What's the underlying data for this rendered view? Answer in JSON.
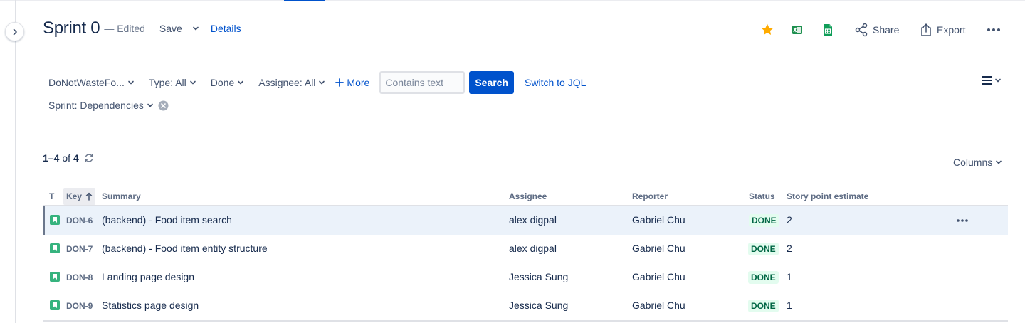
{
  "header": {
    "title": "Sprint 0",
    "edited": "— Edited",
    "save_label": "Save",
    "details_label": "Details",
    "share_label": "Share",
    "export_label": "Export"
  },
  "filters": {
    "project": "DoNotWasteFo...",
    "type": "Type: All",
    "status": "Done",
    "assignee": "Assignee: All",
    "more": "More",
    "search_placeholder": "Contains text",
    "search_button": "Search",
    "jql_link": "Switch to JQL",
    "sprint": "Sprint: Dependencies"
  },
  "results": {
    "range": "1–4",
    "of_label": "of",
    "total": "4",
    "columns_label": "Columns"
  },
  "table": {
    "headers": {
      "type": "T",
      "key": "Key",
      "summary": "Summary",
      "assignee": "Assignee",
      "reporter": "Reporter",
      "status": "Status",
      "story_points": "Story point estimate"
    },
    "rows": [
      {
        "key": "DON-6",
        "summary": "(backend) - Food item search",
        "assignee": "alex digpal",
        "reporter": "Gabriel Chu",
        "status": "DONE",
        "points": "2"
      },
      {
        "key": "DON-7",
        "summary": "(backend) - Food item entity structure",
        "assignee": "alex digpal",
        "reporter": "Gabriel Chu",
        "status": "DONE",
        "points": "2"
      },
      {
        "key": "DON-8",
        "summary": "Landing page design",
        "assignee": "Jessica Sung",
        "reporter": "Gabriel Chu",
        "status": "DONE",
        "points": "1"
      },
      {
        "key": "DON-9",
        "summary": "Statistics page design",
        "assignee": "Jessica Sung",
        "reporter": "Gabriel Chu",
        "status": "DONE",
        "points": "1"
      }
    ]
  },
  "colors": {
    "accent": "#0052cc",
    "star": "#ffab00",
    "story_icon": "#36b37e",
    "done_bg": "#e3fcef",
    "done_text": "#006644",
    "selected_row": "#ebf2fa"
  },
  "icons": [
    "chevron-right-icon",
    "chevron-down-icon",
    "star-icon",
    "excel-icon",
    "google-sheets-icon",
    "share-icon",
    "export-icon",
    "more-icon",
    "plus-icon",
    "clear-icon",
    "list-view-icon",
    "refresh-icon",
    "sort-arrow-up-icon",
    "story-icon"
  ]
}
